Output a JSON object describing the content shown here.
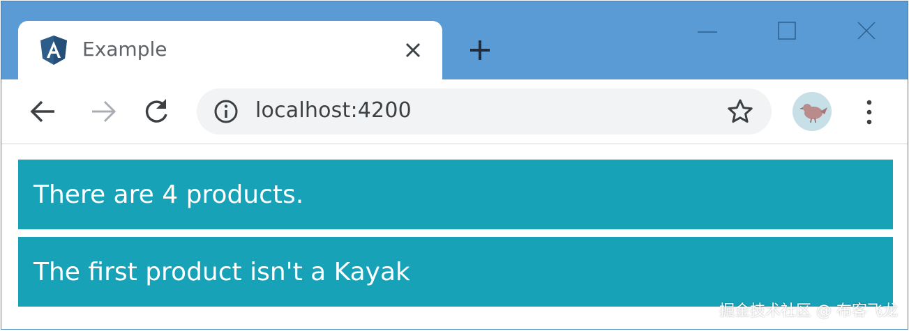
{
  "tab": {
    "title": "Example",
    "favicon": "angular-logo-icon",
    "close": "close-icon"
  },
  "new_tab": "plus-icon",
  "window_controls": [
    "minimize-icon",
    "maximize-icon",
    "close-icon"
  ],
  "toolbar": {
    "back": "arrow-left-icon",
    "forward": "arrow-right-icon",
    "reload": "reload-icon",
    "url": "localhost:4200",
    "site_info": "info-icon",
    "bookmark": "star-icon",
    "profile": "avatar-bird-icon",
    "menu": "more-vertical-icon"
  },
  "content": {
    "alerts": [
      "There are 4 products.",
      "The first product isn't a Kayak"
    ]
  },
  "watermark": "掘金技术社区 @ 布客飞龙",
  "colors": {
    "titlebar": "#5b9bd5",
    "alert_bg": "#17a2b8",
    "alert_text": "#ffffff",
    "favicon_shield": "#2f5d8a"
  }
}
